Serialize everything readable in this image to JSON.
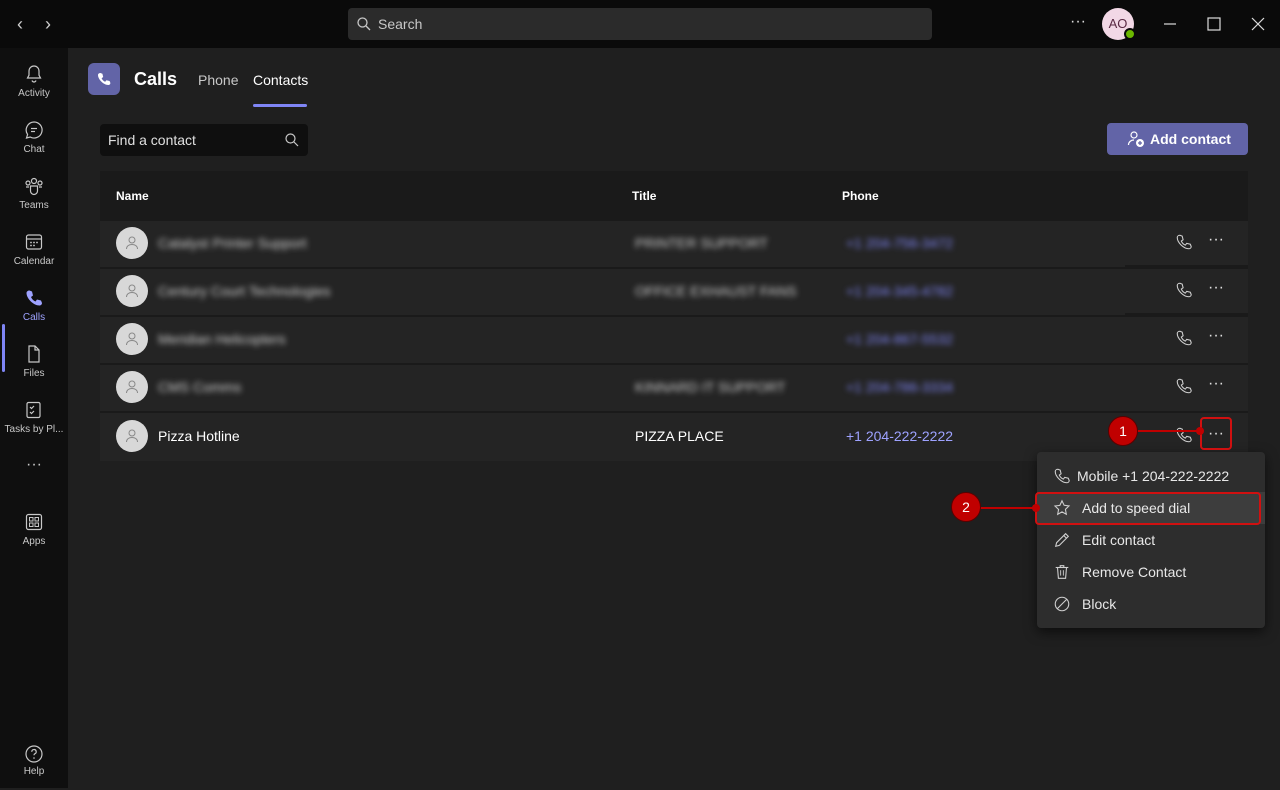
{
  "titlebar": {
    "search_placeholder": "Search",
    "avatar_initials": "AO"
  },
  "rail": {
    "items": [
      {
        "label": "Activity",
        "icon": "bell-icon"
      },
      {
        "label": "Chat",
        "icon": "chat-icon"
      },
      {
        "label": "Teams",
        "icon": "teams-icon"
      },
      {
        "label": "Calendar",
        "icon": "calendar-icon"
      },
      {
        "label": "Calls",
        "icon": "phone-icon"
      },
      {
        "label": "Files",
        "icon": "file-icon"
      },
      {
        "label": "Tasks by Pl...",
        "icon": "tasks-icon"
      },
      {
        "label": "Apps",
        "icon": "apps-icon"
      }
    ],
    "more": "···",
    "help": "Help"
  },
  "header": {
    "title": "Calls",
    "tabs": [
      {
        "label": "Phone"
      },
      {
        "label": "Contacts"
      }
    ]
  },
  "toolbar": {
    "find_placeholder": "Find a contact",
    "add_contact": "Add contact"
  },
  "table": {
    "columns": [
      "Name",
      "Title",
      "Phone"
    ],
    "rows": [
      {
        "name": "Catalyst Printer Support",
        "title": "PRINTER SUPPORT",
        "phone": "+1 204-756-3472",
        "blurred": true
      },
      {
        "name": "Century Court Technologies",
        "title": "OFFICE EXHAUST FANS",
        "phone": "+1 204-345-4782",
        "blurred": true
      },
      {
        "name": "Meridian Helicopters",
        "title": "",
        "phone": "+1 204-867-5532",
        "blurred": true
      },
      {
        "name": "CMS Comms",
        "title": "KINNARD IT SUPPORT",
        "phone": "+1 204-786-3334",
        "blurred": true
      },
      {
        "name": "Pizza Hotline",
        "title": "PIZZA PLACE",
        "phone": "+1 204-222-2222",
        "blurred": false
      }
    ]
  },
  "context_menu": {
    "items": [
      {
        "label": "Mobile +1 204-222-2222",
        "icon": "phone-icon"
      },
      {
        "label": "Add to speed dial",
        "icon": "star-icon"
      },
      {
        "label": "Edit contact",
        "icon": "pencil-icon"
      },
      {
        "label": "Remove Contact",
        "icon": "trash-icon"
      },
      {
        "label": "Block",
        "icon": "block-icon"
      }
    ]
  },
  "callouts": {
    "one": "1",
    "two": "2"
  },
  "colors": {
    "accent": "#6264a7",
    "accent_light": "#7f85f5",
    "callout_red": "#c00000"
  }
}
